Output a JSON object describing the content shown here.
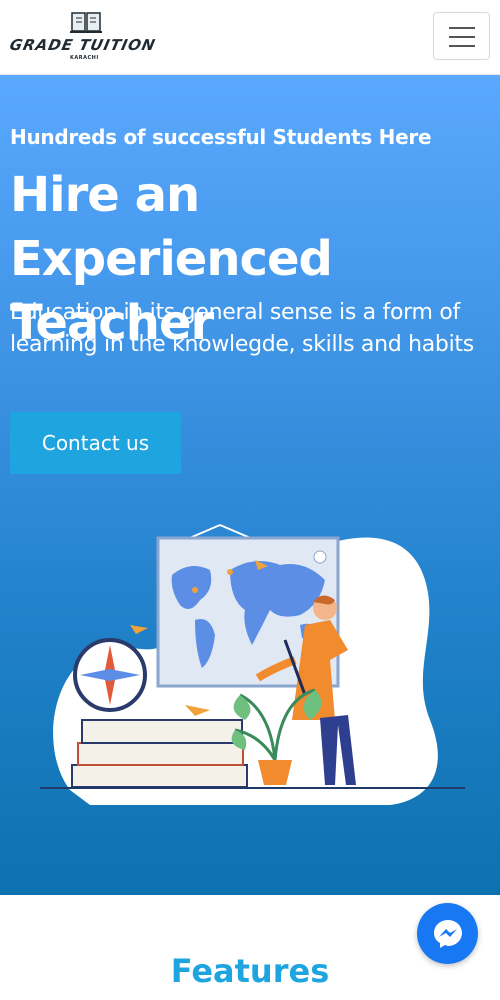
{
  "brand": {
    "name": "GRADE TUITION",
    "sub": "KARACHI"
  },
  "nav": {
    "menu_icon": "hamburger-icon"
  },
  "hero": {
    "eyebrow": "Hundreds of successful Students Here",
    "title": "Hire an Experienced Teacher",
    "description": "Education in its general sense is a form of learning in the knowlegde, skills and habits",
    "cta_label": "Contact us",
    "illustration_icon": "teacher-with-world-map-illustration"
  },
  "features": {
    "title": "Features"
  },
  "chat": {
    "icon": "messenger-icon"
  },
  "colors": {
    "hero_top": "#5aa8ff",
    "hero_bottom": "#0d72af",
    "accent": "#1ea5df",
    "messenger": "#1877f2"
  }
}
